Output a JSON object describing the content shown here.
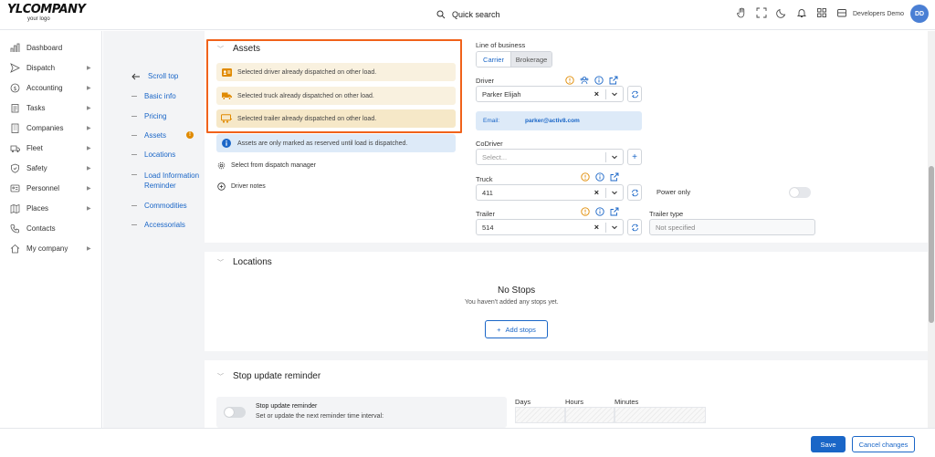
{
  "header": {
    "logo_main": "YLCOMPANY",
    "logo_sub": "your logo",
    "search_label": "Quick search",
    "user_name": "Developers Demo",
    "avatar_initials": "DD"
  },
  "sidebar": {
    "items": [
      {
        "label": "Dashboard"
      },
      {
        "label": "Dispatch"
      },
      {
        "label": "Accounting"
      },
      {
        "label": "Tasks"
      },
      {
        "label": "Companies"
      },
      {
        "label": "Fleet"
      },
      {
        "label": "Safety"
      },
      {
        "label": "Personnel"
      },
      {
        "label": "Places"
      },
      {
        "label": "Contacts"
      },
      {
        "label": "My company"
      }
    ]
  },
  "nav": {
    "scroll_top": "Scroll top",
    "items": [
      {
        "label": "Basic info"
      },
      {
        "label": "Pricing"
      },
      {
        "label": "Assets"
      },
      {
        "label": "Locations"
      },
      {
        "label": "Load Information Reminder"
      },
      {
        "label": "Commodities"
      },
      {
        "label": "Accessorials"
      }
    ],
    "assets_badge": "!"
  },
  "assets": {
    "title": "Assets",
    "alerts": [
      {
        "text": "Selected driver already dispatched on other load."
      },
      {
        "text": "Selected truck already dispatched on other load."
      },
      {
        "text": "Selected trailer already dispatched on other load."
      }
    ],
    "info": "Assets are only marked as reserved until load is dispatched.",
    "select_from_dispatch": "Select from dispatch manager",
    "driver_notes": "Driver notes"
  },
  "form": {
    "line_of_business_label": "Line of business",
    "carrier": "Carrier",
    "brokerage": "Brokerage",
    "driver_label": "Driver",
    "driver_value": "Parker Elijah",
    "email_label": "Email:",
    "email_value": "parker@activ8.com",
    "codriver_label": "CoDriver",
    "codriver_placeholder": "Select...",
    "truck_label": "Truck",
    "truck_value": "411",
    "power_only_label": "Power only",
    "trailer_label": "Trailer",
    "trailer_value": "514",
    "trailer_type_label": "Trailer type",
    "trailer_type_value": "Not specified"
  },
  "locations": {
    "title": "Locations",
    "no_stops_title": "No Stops",
    "no_stops_sub": "You haven't added any stops yet.",
    "add_stops": "Add stops"
  },
  "reminder": {
    "title": "Stop update reminder",
    "toggle_label": "Stop update reminder",
    "toggle_sub": "Set or update the next reminder time interval:",
    "days": "Days",
    "hours": "Hours",
    "minutes": "Minutes"
  },
  "footer": {
    "save": "Save",
    "cancel": "Cancel changes"
  },
  "colors": {
    "accent": "#1a66c7",
    "highlight": "#f0621a",
    "warning": "#e08a00"
  }
}
